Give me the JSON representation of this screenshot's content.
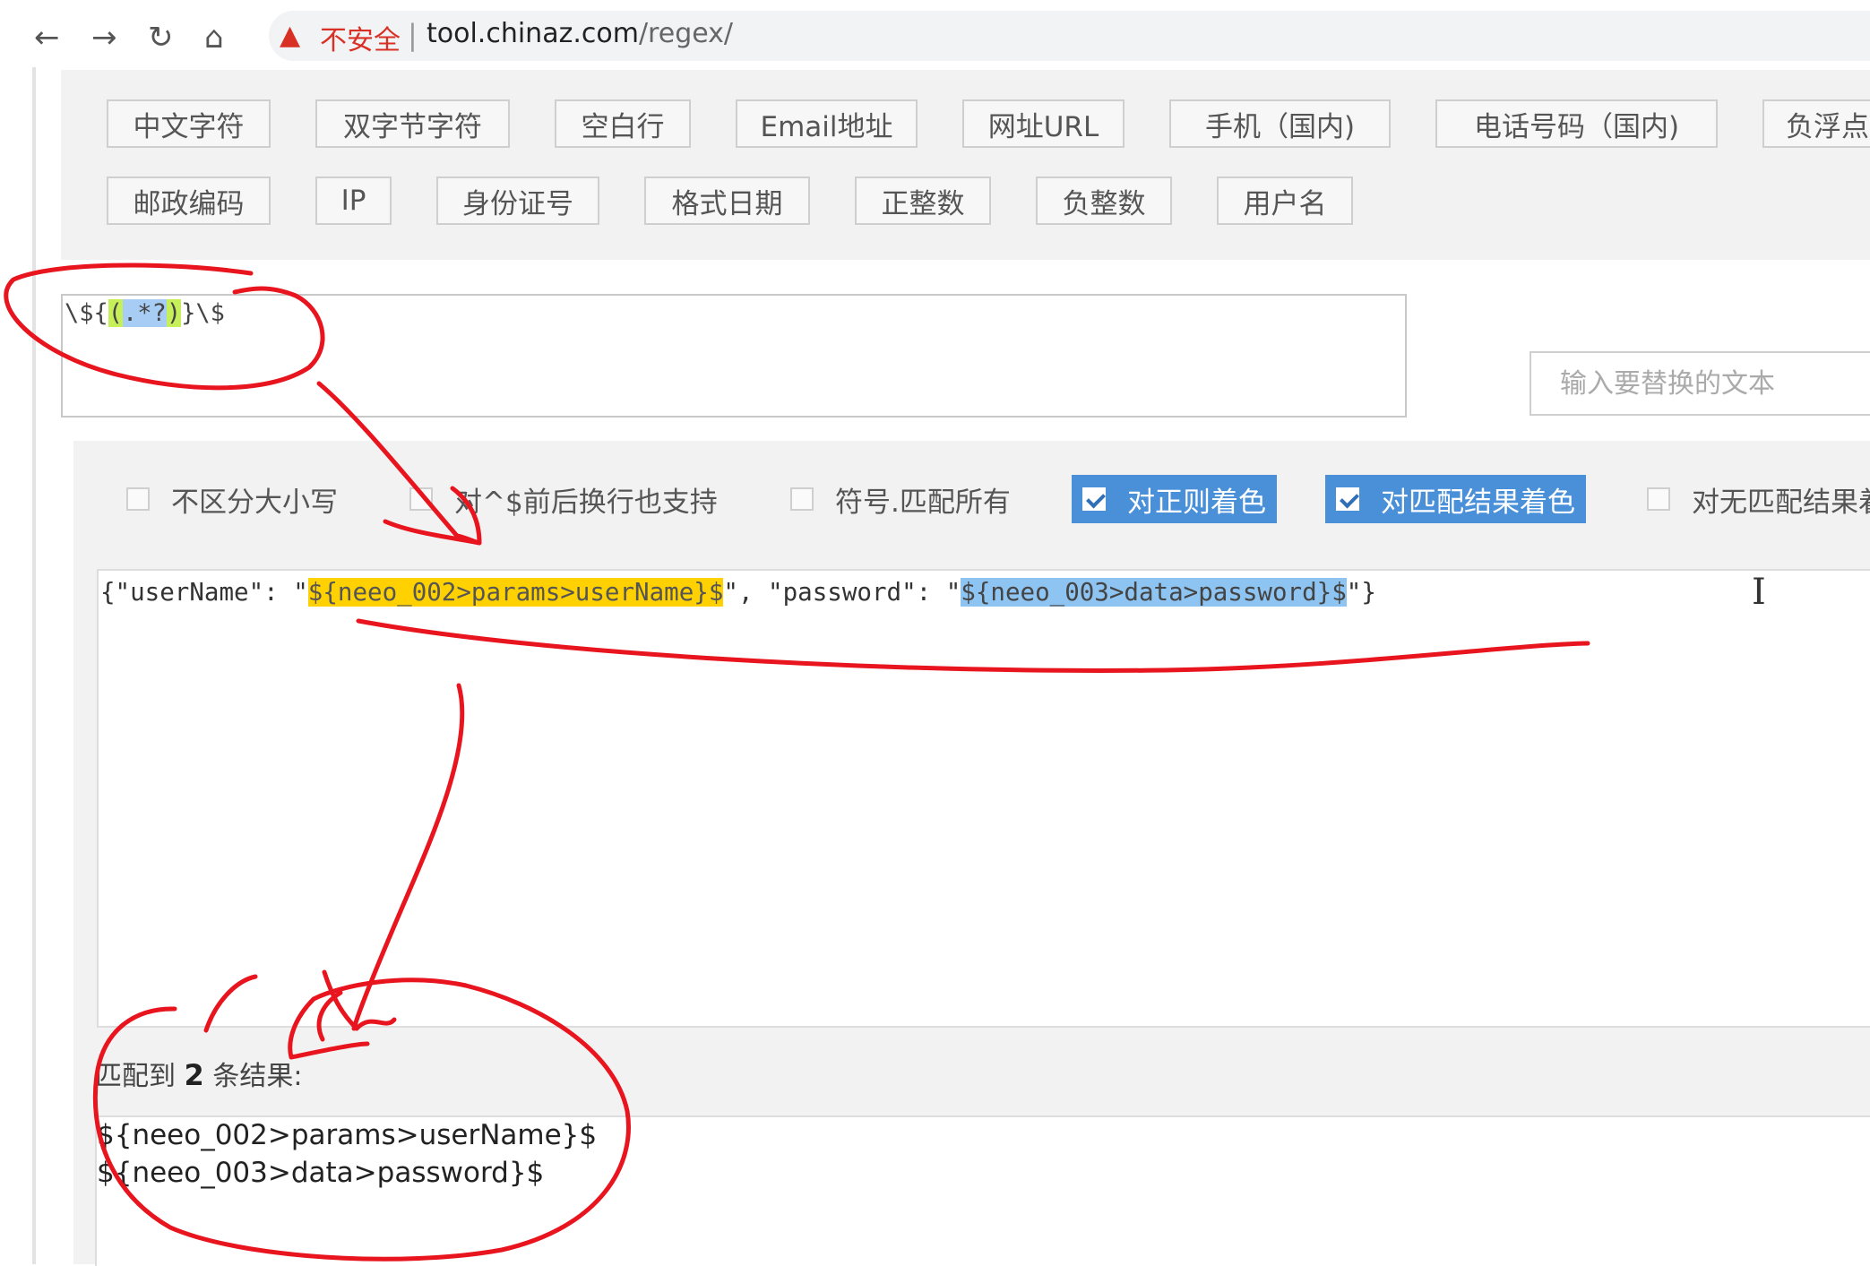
{
  "browser": {
    "security_icon": "warning-triangle-icon",
    "security_label": "不安全",
    "url_host": "tool.chinaz.com",
    "url_path": "/regex/"
  },
  "quick_buttons": {
    "row1": [
      "中文字符",
      "双字节字符",
      "空白行",
      "Email地址",
      "网址URL",
      "手机（国内)",
      "电话号码（国内)",
      "负浮点"
    ],
    "row2": [
      "邮政编码",
      "IP",
      "身份证号",
      "格式日期",
      "正整数",
      "负整数",
      "用户名"
    ]
  },
  "regex": {
    "prefix": "\\${",
    "group_open": "(",
    "group_body": ".*?",
    "group_close": ")",
    "suffix": "}\\$"
  },
  "replace": {
    "placeholder": "输入要替换的文本"
  },
  "options": [
    {
      "label": "不区分大小写",
      "checked": false
    },
    {
      "label": "对^$前后换行也支持",
      "checked": false
    },
    {
      "label": "符号.匹配所有",
      "checked": false
    },
    {
      "label": "对正则着色",
      "checked": true
    },
    {
      "label": "对匹配结果着色",
      "checked": true
    },
    {
      "label": "对无匹配结果着",
      "checked": false
    }
  ],
  "test_text": {
    "part1": "{\"userName\": \"",
    "match1": "${neeo_002>params>userName}$",
    "part2": "\", \"password\": \"",
    "match2": "${neeo_003>data>password}$",
    "part3": "\"}"
  },
  "result": {
    "prefix": "匹配到",
    "count": "2",
    "suffix": "条结果:",
    "items": [
      "${neeo_002>params>userName}$",
      "${neeo_003>data>password}$"
    ]
  },
  "colors": {
    "annotation": "#e8141e",
    "match_yellow": "#ffd100",
    "match_blue": "#8ec4f2",
    "checked_option": "#4a90d9"
  }
}
